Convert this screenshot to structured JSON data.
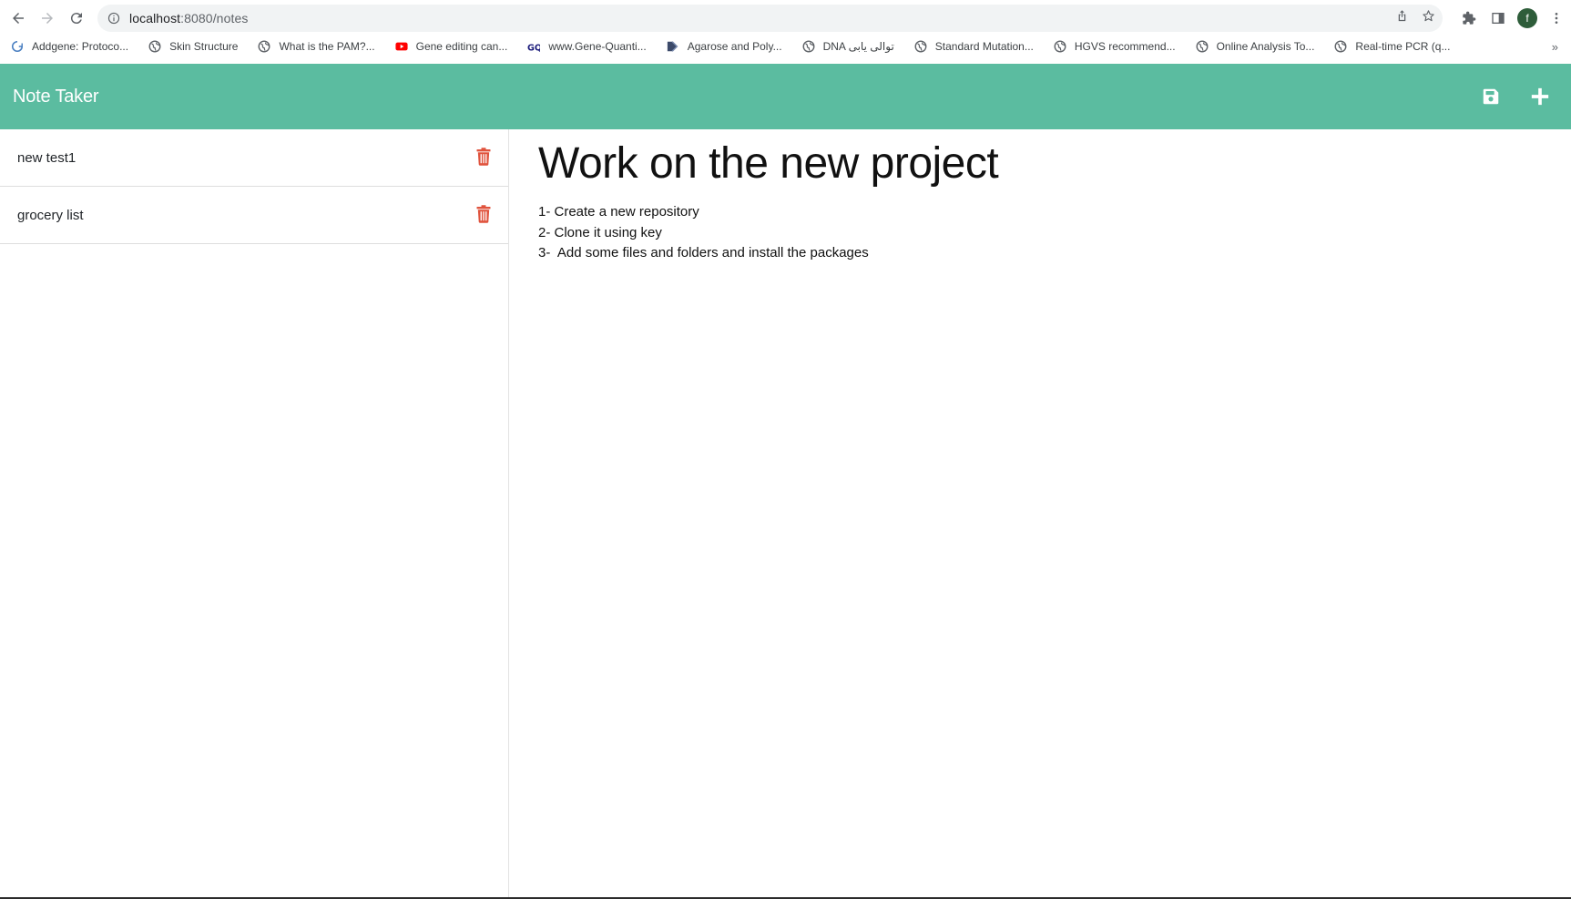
{
  "browser": {
    "url_host": "localhost",
    "url_path": ":8080/notes",
    "profile_initial": "f",
    "bookmarks": [
      {
        "label": "Addgene: Protoco...",
        "icon": "addgene-icon"
      },
      {
        "label": "Skin Structure",
        "icon": "globe-icon"
      },
      {
        "label": "What is the PAM?...",
        "icon": "globe-icon"
      },
      {
        "label": "Gene editing can...",
        "icon": "youtube-icon"
      },
      {
        "label": "www.Gene-Quanti...",
        "icon": "gq-icon"
      },
      {
        "label": "Agarose and Poly...",
        "icon": "chevron-logo-icon"
      },
      {
        "label": "DNA توالی یابی",
        "icon": "globe-icon"
      },
      {
        "label": "Standard Mutation...",
        "icon": "globe-icon"
      },
      {
        "label": "HGVS recommend...",
        "icon": "globe-icon"
      },
      {
        "label": "Online Analysis To...",
        "icon": "globe-icon"
      },
      {
        "label": "Real-time PCR (q...",
        "icon": "globe-icon"
      }
    ],
    "more_label": "»"
  },
  "app": {
    "brand": "Note Taker",
    "accent_color": "#5bbca0",
    "delete_color": "#e0533d"
  },
  "notes": [
    {
      "title": "new test1"
    },
    {
      "title": "grocery list"
    }
  ],
  "active_note": {
    "title": "Work on the new project",
    "lines": [
      "1- Create a new repository",
      "2- Clone it using key",
      "3-  Add some files and folders and install the packages"
    ]
  }
}
